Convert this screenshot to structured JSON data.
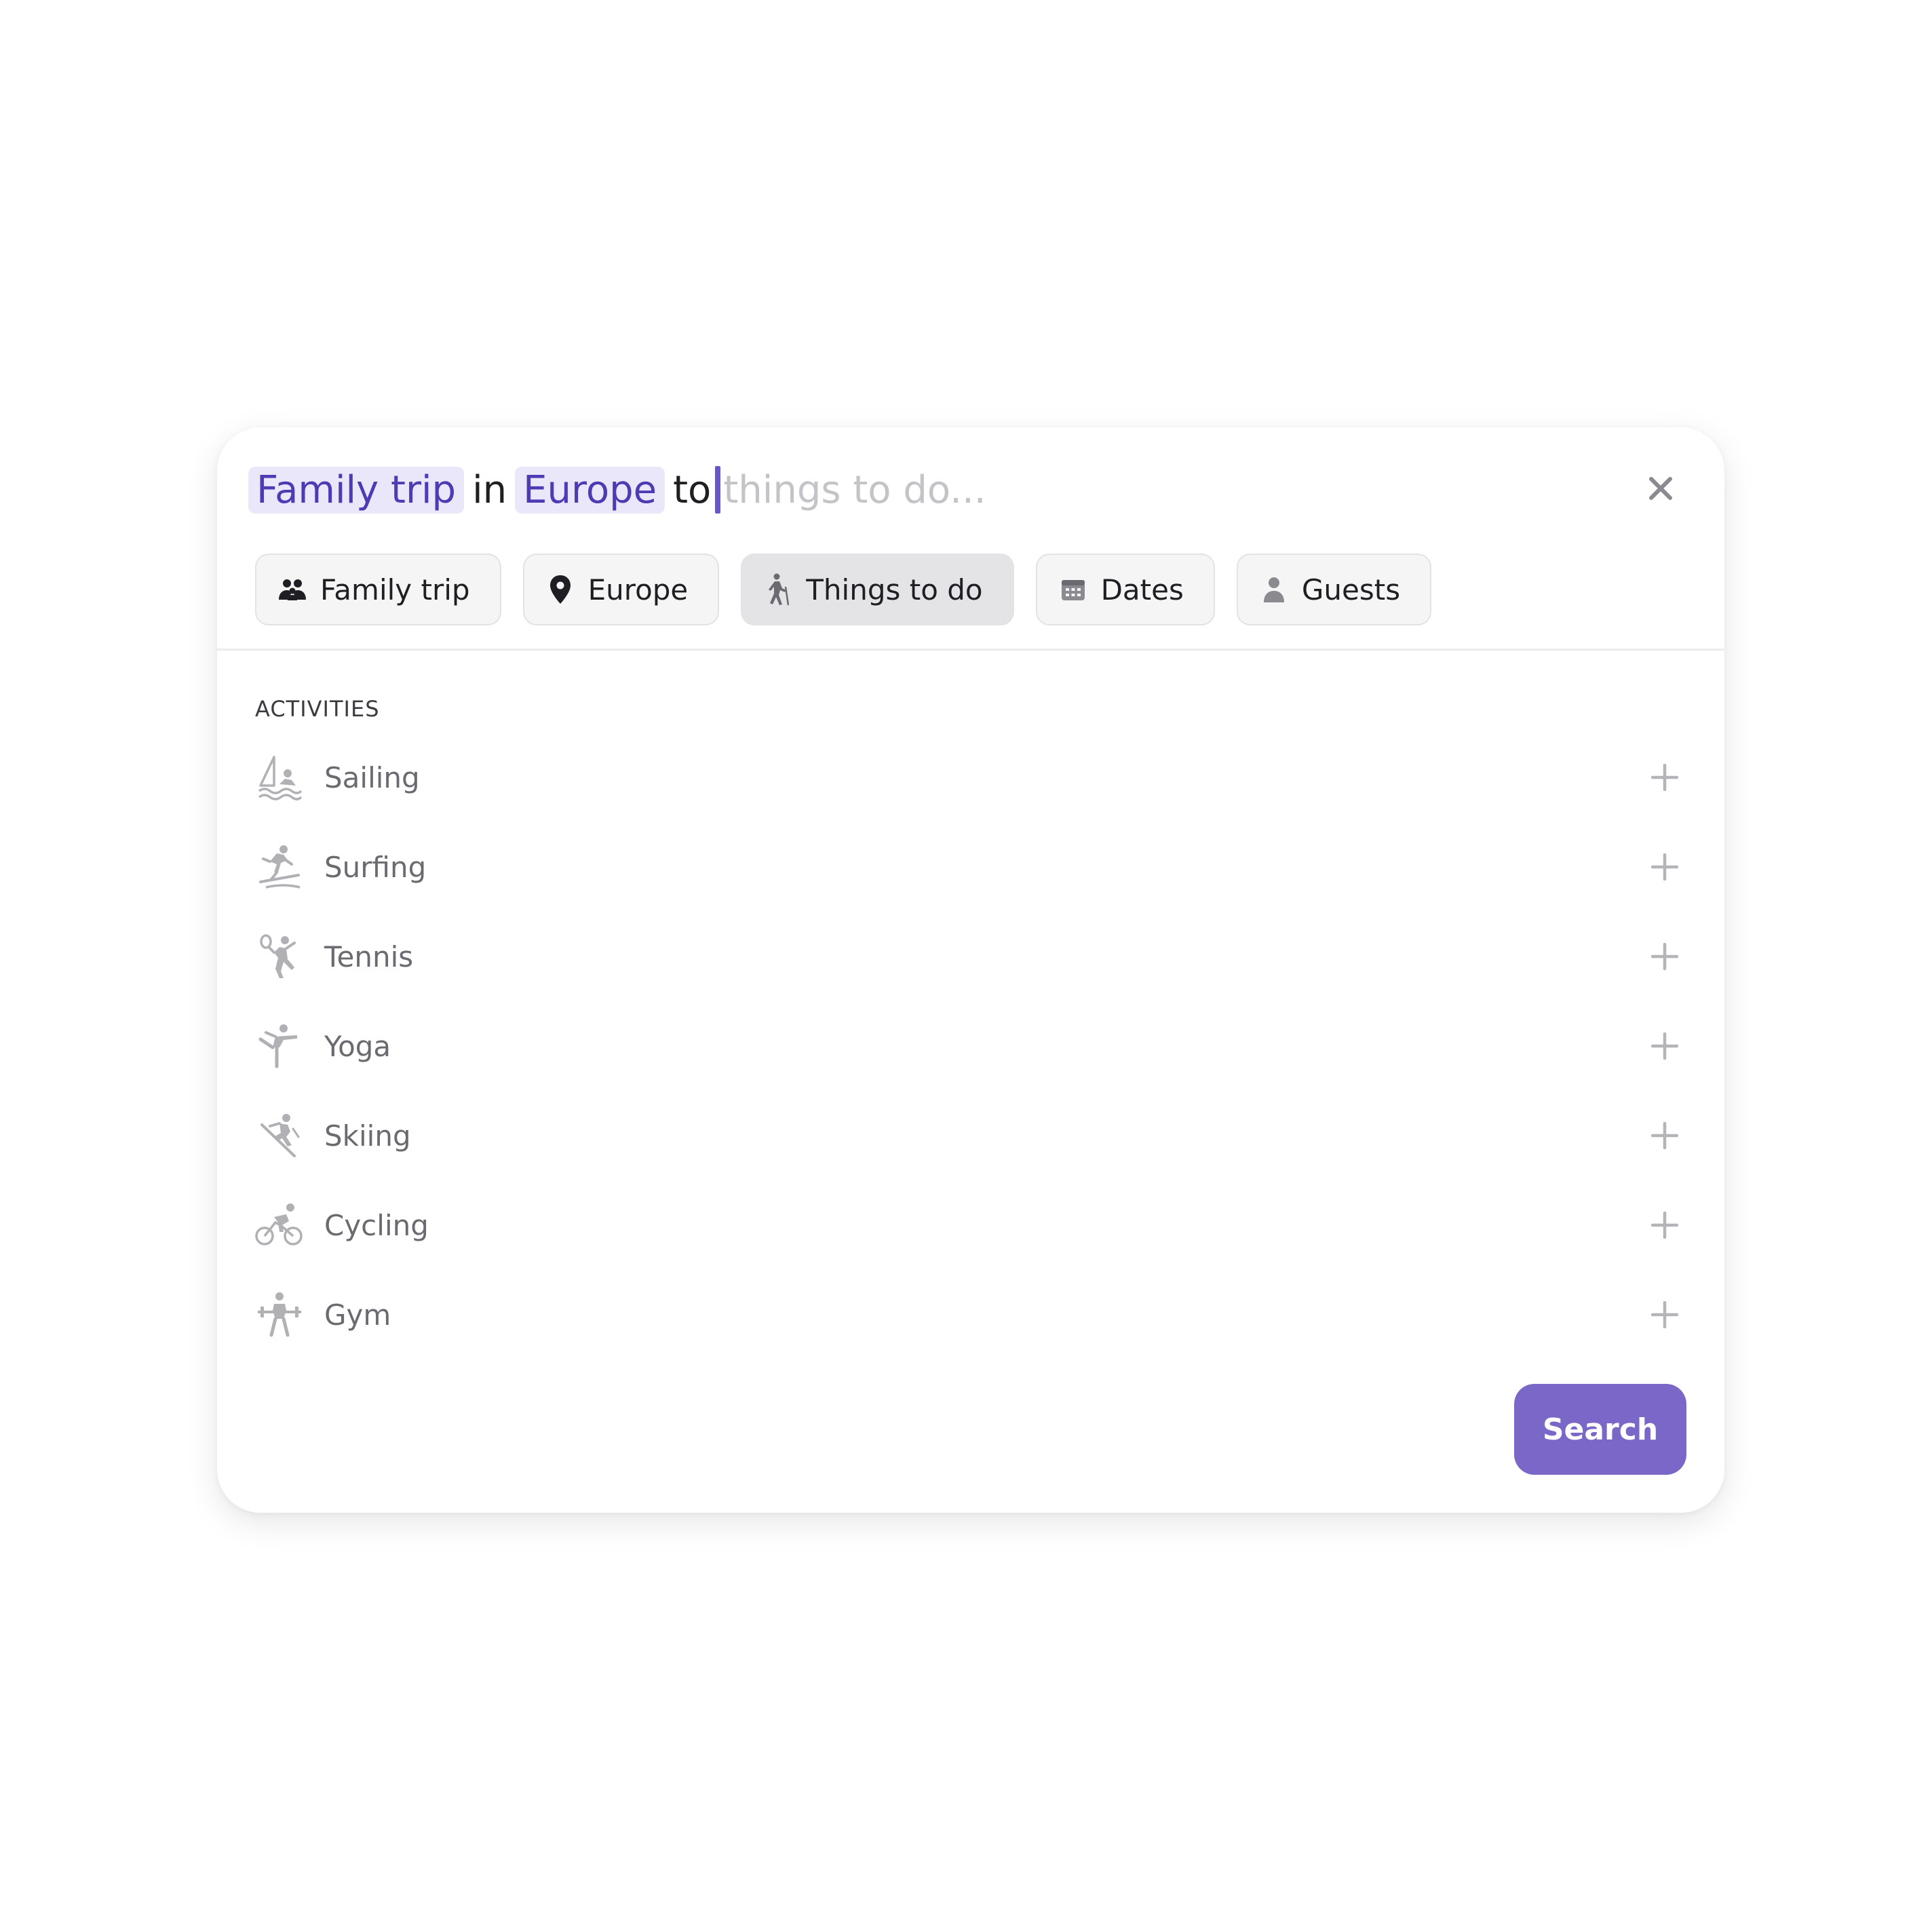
{
  "query": {
    "token_1": "Family trip",
    "word_1": "in",
    "token_2": "Europe",
    "word_2": "to",
    "placeholder": "things to do..."
  },
  "chips": [
    {
      "label": "Family trip",
      "icon": "family-icon"
    },
    {
      "label": "Europe",
      "icon": "location-pin-icon"
    },
    {
      "label": "Things to do",
      "icon": "hiking-icon",
      "selected": true
    },
    {
      "label": "Dates",
      "icon": "calendar-icon"
    },
    {
      "label": "Guests",
      "icon": "person-icon"
    }
  ],
  "section_title": "ACTIVITIES",
  "activities": [
    {
      "label": "Sailing",
      "icon": "sailing-icon"
    },
    {
      "label": "Surfing",
      "icon": "surfing-icon"
    },
    {
      "label": "Tennis",
      "icon": "tennis-icon"
    },
    {
      "label": "Yoga",
      "icon": "yoga-icon"
    },
    {
      "label": "Skiing",
      "icon": "skiing-icon"
    },
    {
      "label": "Cycling",
      "icon": "cycling-icon"
    },
    {
      "label": "Gym",
      "icon": "gym-icon"
    }
  ],
  "search_label": "Search",
  "colors": {
    "accent": "#7a67c8",
    "token_bg": "#ebe7fb",
    "token_text": "#4c3bb3"
  }
}
